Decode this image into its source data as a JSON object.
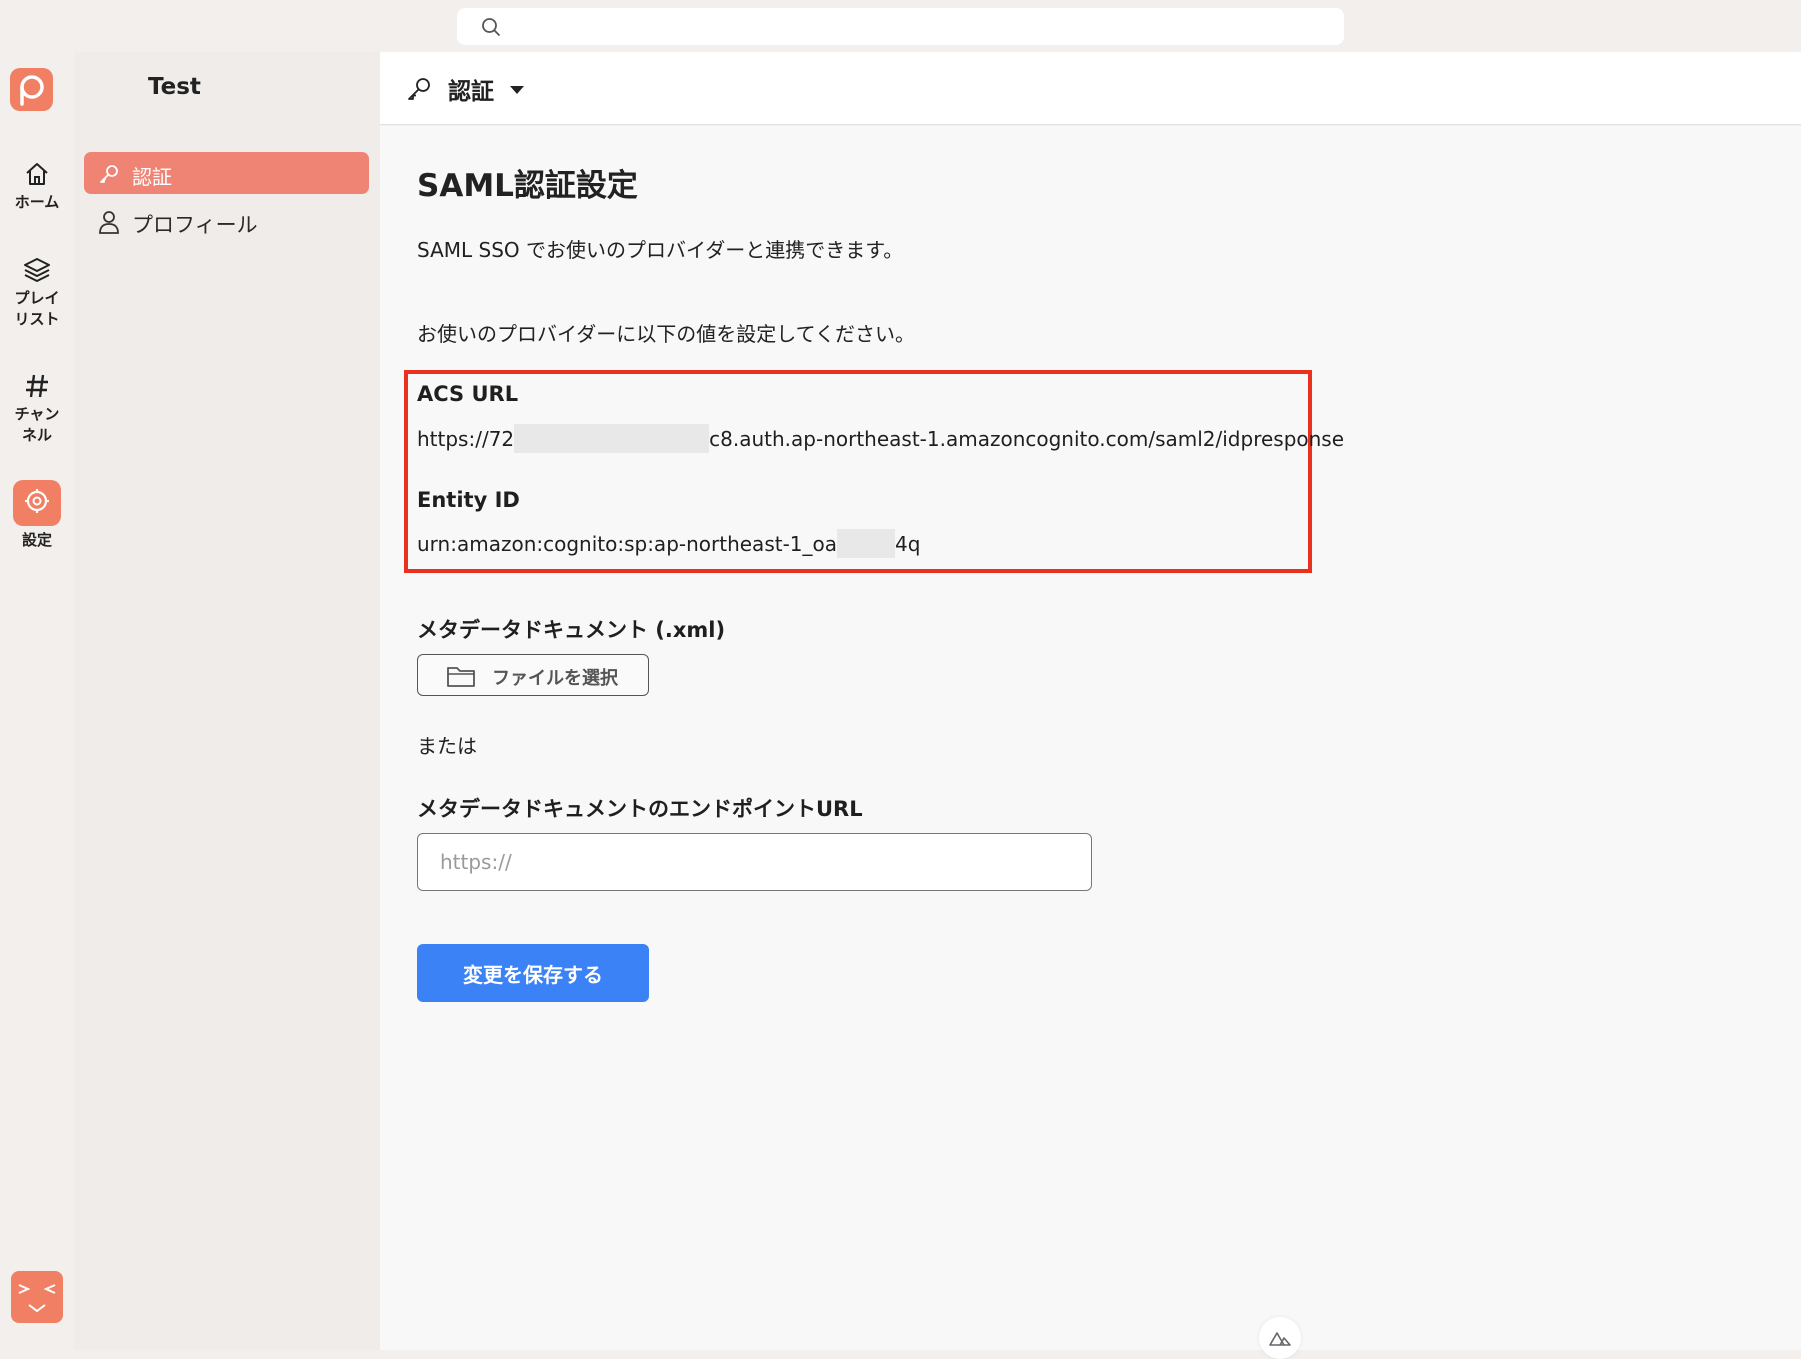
{
  "search": {
    "placeholder": ""
  },
  "workspace": {
    "name": "Test"
  },
  "rail": {
    "home": "ホーム",
    "playlist_line1": "プレイ",
    "playlist_line2": "リスト",
    "channel_line1": "チャン",
    "channel_line2": "ネル",
    "settings": "設定"
  },
  "sidebar": {
    "items": [
      {
        "label": "認証",
        "active": true,
        "icon": "key-icon"
      },
      {
        "label": "プロフィール",
        "active": false,
        "icon": "person-icon"
      }
    ]
  },
  "header": {
    "title": "認証"
  },
  "page": {
    "title": "SAML認証設定",
    "description": "SAML SSO でお使いのプロバイダーと連携できます。",
    "instruction": "お使いのプロバイダーに以下の値を設定してください。",
    "acs_label": "ACS URL",
    "acs_prefix": "https://72",
    "acs_suffix": "c8.auth.ap-northeast-1.amazoncognito.com/saml2/idpresponse",
    "entity_label": "Entity ID",
    "entity_prefix": "urn:amazon:cognito:sp:ap-northeast-1_oa",
    "entity_suffix": "4q",
    "metadata_label": "メタデータドキュメント (.xml)",
    "file_button": "ファイルを選択",
    "or_text": "または",
    "endpoint_label": "メタデータドキュメントのエンドポイントURL",
    "endpoint_placeholder": "https://",
    "save_button": "変更を保存する"
  },
  "colors": {
    "accent": "#f07f63",
    "highlight_border": "#e8321e",
    "primary_button": "#3b82f6"
  }
}
